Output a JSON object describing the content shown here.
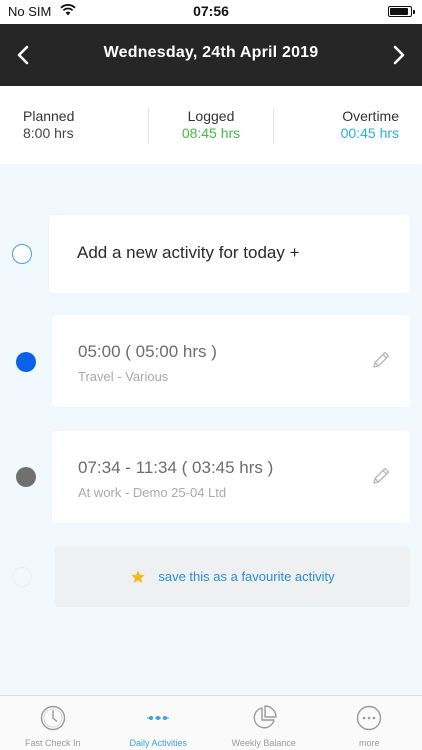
{
  "status_bar": {
    "carrier": "No SIM",
    "time": "07:56",
    "battery_level": 0.9
  },
  "header": {
    "title": "Wednesday, 24th April 2019",
    "prev_icon": "chevron-left-icon",
    "next_icon": "chevron-right-icon"
  },
  "summary": {
    "planned": {
      "label": "Planned",
      "value": "8:00 hrs"
    },
    "logged": {
      "label": "Logged",
      "value": "08:45 hrs"
    },
    "overtime": {
      "label": "Overtime",
      "value": "00:45 hrs"
    }
  },
  "add_activity": {
    "label": "Add a new activity for today +"
  },
  "activities": [
    {
      "time_range": "05:00 ( 05:00 hrs )",
      "description": "Travel - Various",
      "dot_color": "#0b62e8"
    },
    {
      "time_range": "07:34 - 11:34 ( 03:45 hrs )",
      "description": "At work - Demo 25-04 Ltd",
      "dot_color": "#707070"
    }
  ],
  "favourite": {
    "label": "save this as a favourite activity",
    "icon": "star-icon"
  },
  "tabs": [
    {
      "label": "Fast Check In",
      "icon": "clock-icon",
      "active": false
    },
    {
      "label": "Daily Activities",
      "icon": "timeline-icon",
      "active": true
    },
    {
      "label": "Weekly Balance",
      "icon": "pie-chart-icon",
      "active": false
    },
    {
      "label": "more",
      "icon": "more-icon",
      "active": false
    }
  ],
  "colors": {
    "header_bg": "#262626",
    "logged": "#49b749",
    "overtime": "#2eaee0",
    "accent": "#3aa0dc",
    "star": "#f5b921"
  }
}
